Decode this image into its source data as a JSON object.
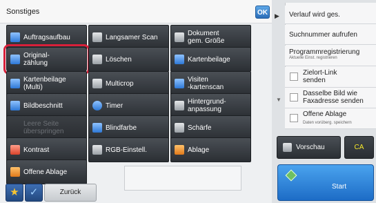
{
  "panel": {
    "title": "Sonstiges",
    "ok_label": "OK"
  },
  "buttons": [
    {
      "label": "Auftragsaufbau",
      "icon": "folder-icon",
      "color": "blue"
    },
    {
      "label": "Langsamer Scan",
      "icon": "document-icon",
      "color": "gray"
    },
    {
      "label": "Dokument\ngem. Größe",
      "icon": "document-size-icon",
      "color": "gray"
    },
    {
      "label": "Original-\nzählung",
      "icon": "count-icon",
      "color": "blue",
      "selected": true
    },
    {
      "label": "Löschen",
      "icon": "erase-icon",
      "color": "gray"
    },
    {
      "label": "Kartenbeilage",
      "icon": "card-icon",
      "color": "blue"
    },
    {
      "label": "Kartenbeilage\n(Multi)",
      "icon": "multi-card-icon",
      "color": "blue"
    },
    {
      "label": "Multicrop",
      "icon": "crop-icon",
      "color": "gray"
    },
    {
      "label": "Visiten\n-kartenscan",
      "icon": "business-card-icon",
      "color": "blue"
    },
    {
      "label": "Bildbeschnitt",
      "icon": "crop-image-icon",
      "color": "blue"
    },
    {
      "label": "Timer",
      "icon": "clock-icon",
      "color": "blue"
    },
    {
      "label": "Hintergrund-\nanpassung",
      "icon": "background-icon",
      "color": "gray"
    },
    {
      "label": "Leere Seite\nüberspringen",
      "icon": "blank-page-icon",
      "color": "gray",
      "disabled": true
    },
    {
      "label": "Blindfarbe",
      "icon": "dropout-color-icon",
      "color": "blue"
    },
    {
      "label": "Schärfe",
      "icon": "sharpness-icon",
      "color": "gray"
    },
    {
      "label": "Kontrast",
      "icon": "contrast-icon",
      "color": "red"
    },
    {
      "label": "RGB-Einstell.",
      "icon": "rgb-icon",
      "color": "gray"
    },
    {
      "label": "Ablage",
      "icon": "folder-icon",
      "color": "orange"
    },
    {
      "label": "Offene Ablage",
      "icon": "open-folder-icon",
      "color": "orange"
    }
  ],
  "bottom": {
    "star": "★",
    "check": "✓",
    "back_label": "Zurück"
  },
  "right": {
    "toggle": "▶",
    "history": "Verlauf wird ges.",
    "search_number": "Suchnummer aufrufen",
    "program": "Programmregistrierung",
    "program_sub": "Aktuelle Einst. registrieren",
    "cb1": "Zielort-Link\nsenden",
    "cb2": "Dasselbe Bild wie\nFaxadresse senden",
    "cb3": "Offene Ablage",
    "cb3_sub": "Daten vorüberg. speichern",
    "scroll": "▼",
    "preview": "Vorschau",
    "ca": "CA",
    "start": "Start"
  }
}
